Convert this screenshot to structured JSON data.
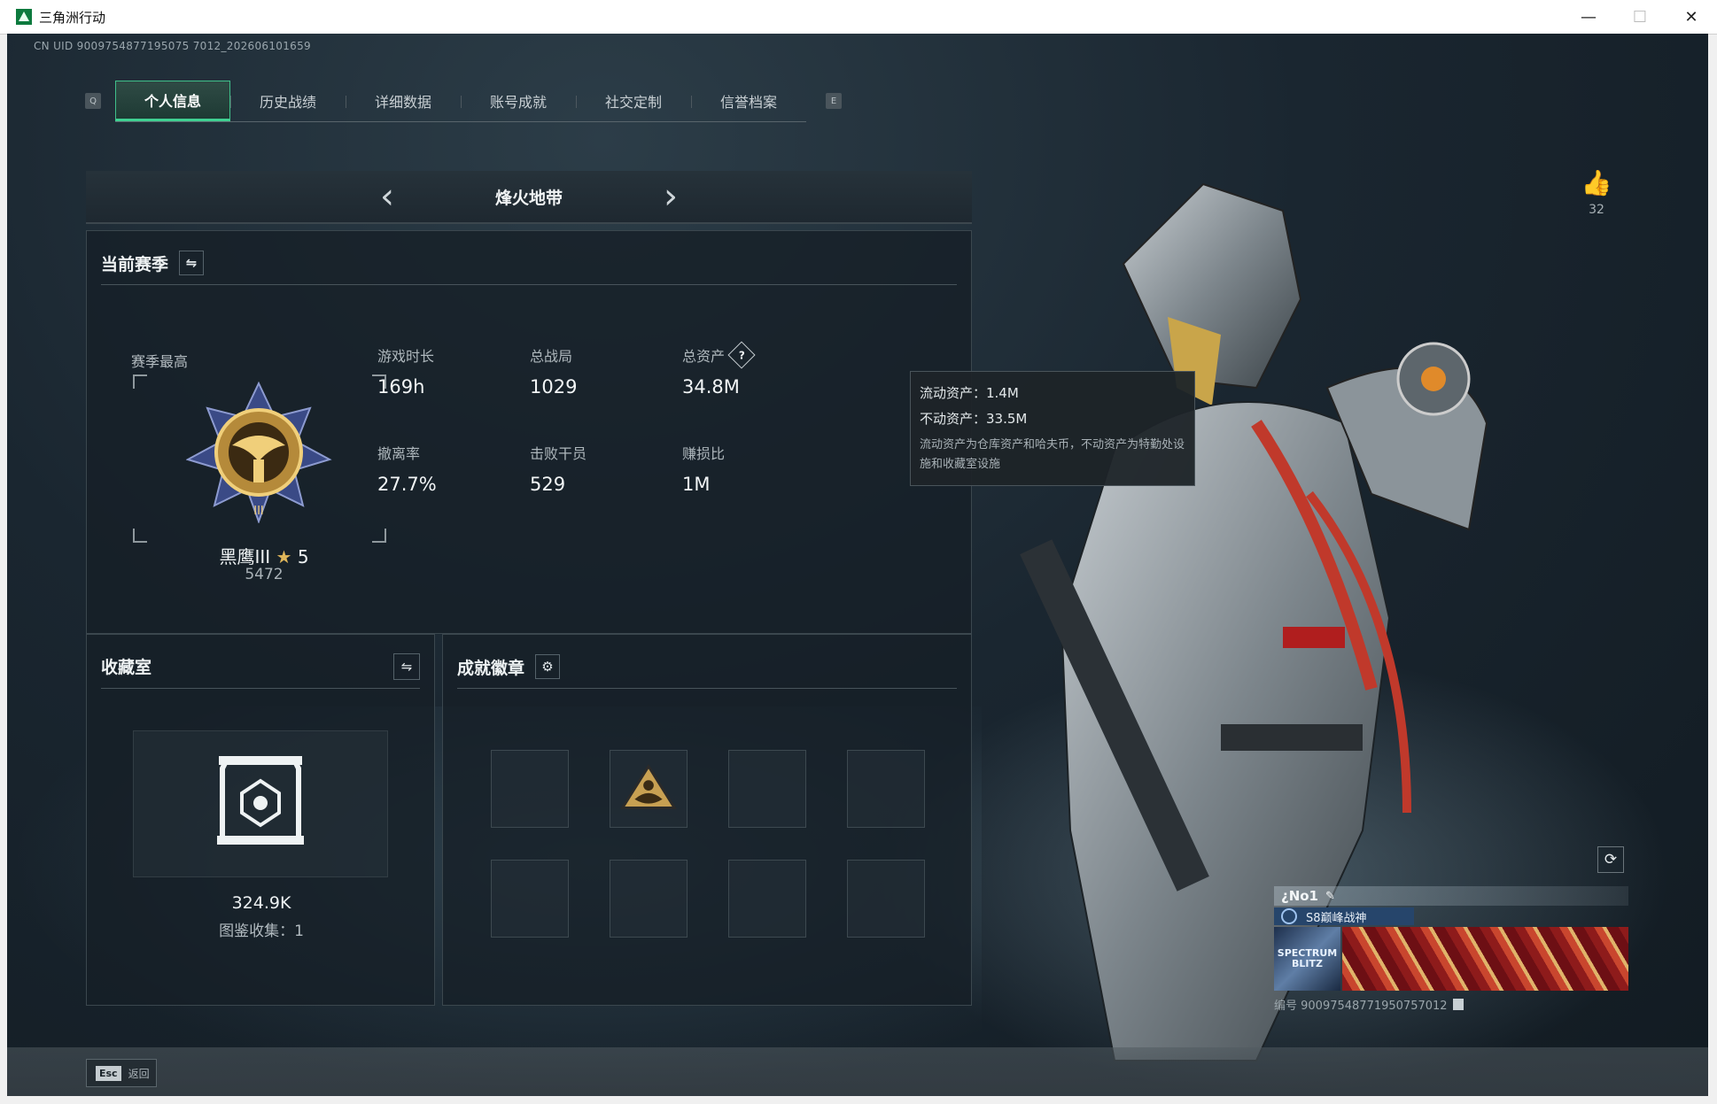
{
  "window": {
    "title": "三角洲行动",
    "minimize": "—",
    "maximize": "☐",
    "close": "✕"
  },
  "uid": "CN UID 9009754877195075 7012_202606101659",
  "tab_keys": {
    "left": "Q",
    "right": "E"
  },
  "tabs": [
    {
      "label": "个人信息",
      "active": true
    },
    {
      "label": "历史战绩"
    },
    {
      "label": "详细数据"
    },
    {
      "label": "账号成就"
    },
    {
      "label": "社交定制"
    },
    {
      "label": "信誉档案"
    }
  ],
  "mode": {
    "prev": "‹",
    "title": "烽火地带",
    "next": "›"
  },
  "season": {
    "title": "当前赛季",
    "best_label": "赛季最高",
    "rank_name": "黑鹰III",
    "rank_stars": "5",
    "rank_score": "5472",
    "stats": [
      {
        "label": "游戏时长",
        "value": "169h"
      },
      {
        "label": "总战局",
        "value": "1029"
      },
      {
        "label": "总资产",
        "value": "34.8M"
      },
      {
        "label": "撤离率",
        "value": "27.7%"
      },
      {
        "label": "击败干员",
        "value": "529"
      },
      {
        "label": "赚损比",
        "value": "1M"
      }
    ]
  },
  "tooltip": {
    "liquid": "流动资产：1.4M",
    "fixed": "不动资产：33.5M",
    "note": "流动资产为仓库资产和哈夫币，不动资产为特勤处设施和收藏室设施"
  },
  "collection": {
    "title": "收藏室",
    "value": "324.9K",
    "sub": "图鉴收集：1"
  },
  "achievements": {
    "title": "成就徽章",
    "slots_total": 8,
    "filled_slot_index": 1
  },
  "likes": {
    "count": "32"
  },
  "card": {
    "name": "¿No1",
    "title": "S8巅峰战神",
    "badge_text": "SPECTRUM BLITZ",
    "id_text": "编号 90097548771950757012"
  },
  "esc": {
    "key": "Esc",
    "label": "返回"
  },
  "colors": {
    "accent": "#3fd192",
    "gold": "#e0b75a"
  }
}
